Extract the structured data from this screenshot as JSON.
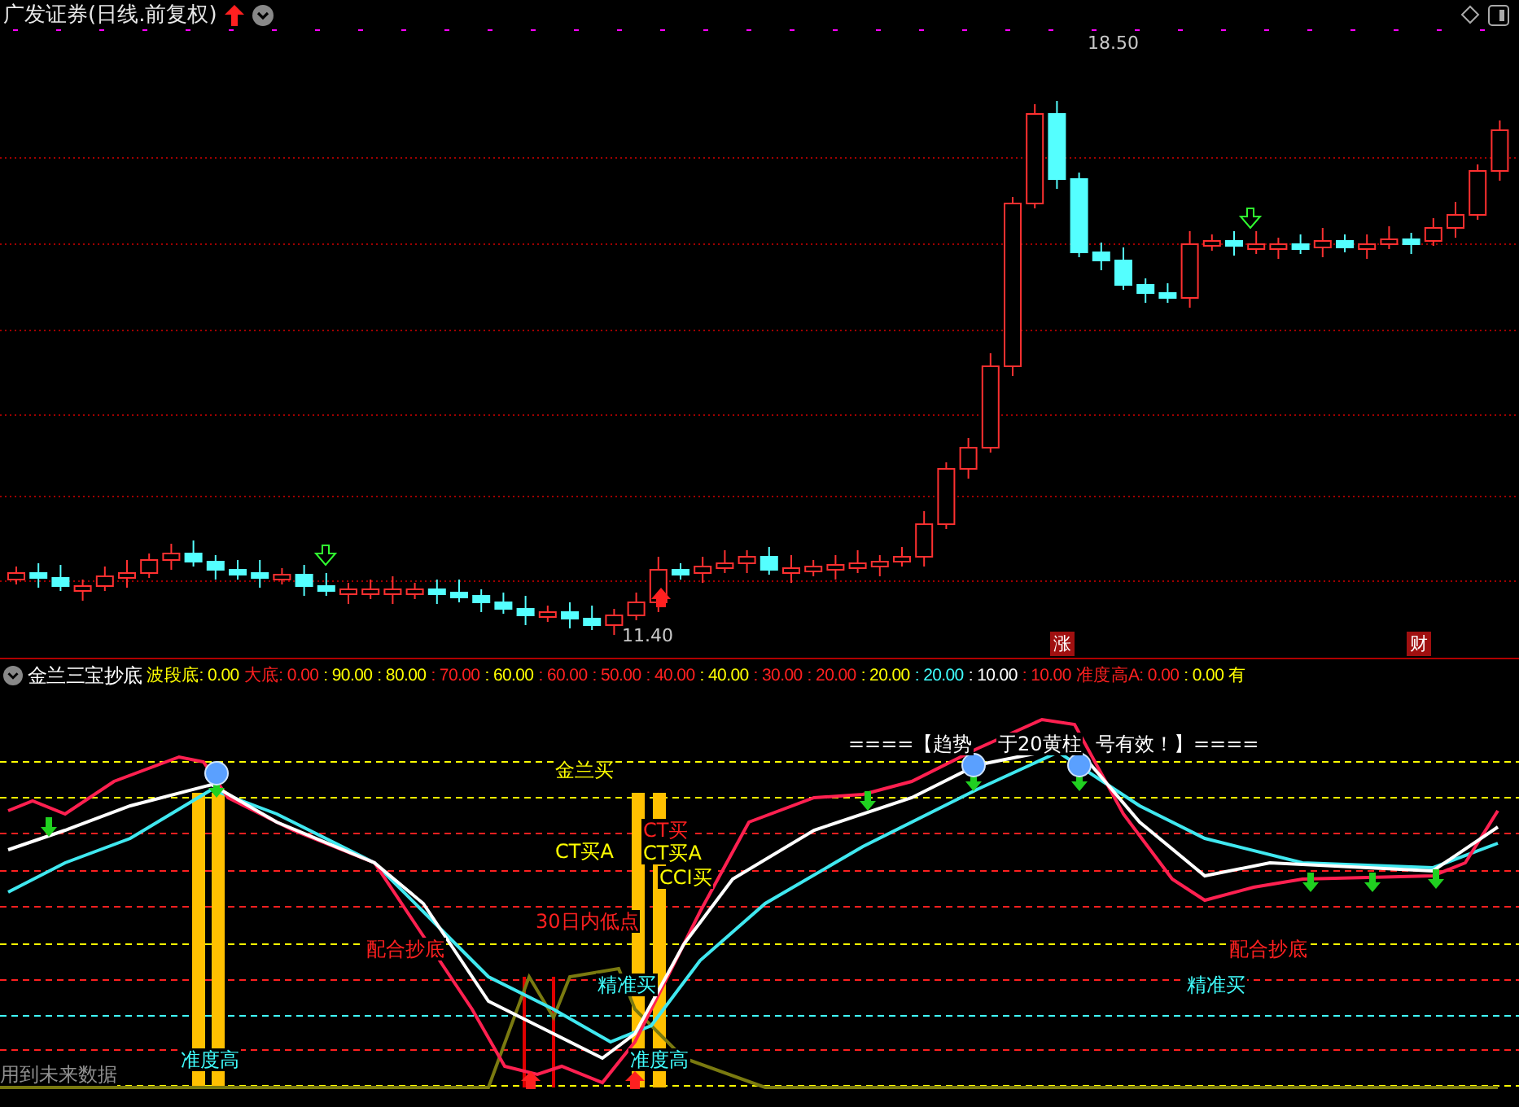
{
  "header": {
    "title": "广发证券(日线.前复权)"
  },
  "price_chart": {
    "high_label": "18.50",
    "low_label": "11.40",
    "badges": [
      "涨",
      "财"
    ]
  },
  "indicator": {
    "name": "金兰三宝抄底",
    "legend": [
      {
        "text": "波段底: 0.00",
        "color": "#ffff00"
      },
      {
        "text": "大底: 0.00",
        "color": "#ff2020"
      },
      {
        "text": ": 90.00",
        "color": "#ffff00"
      },
      {
        "text": ": 80.00",
        "color": "#ffff00"
      },
      {
        "text": ": 70.00",
        "color": "#ff2020"
      },
      {
        "text": ": 60.00",
        "color": "#ffff00"
      },
      {
        "text": ": 60.00",
        "color": "#ff2020"
      },
      {
        "text": ": 50.00",
        "color": "#ff2020"
      },
      {
        "text": ": 40.00",
        "color": "#ff2020"
      },
      {
        "text": ": 40.00",
        "color": "#ffff00"
      },
      {
        "text": ": 30.00",
        "color": "#ff2020"
      },
      {
        "text": ": 20.00",
        "color": "#ff2020"
      },
      {
        "text": ": 20.00",
        "color": "#ffff00"
      },
      {
        "text": ": 20.00",
        "color": "#40ffff"
      },
      {
        "text": ": 10.00",
        "color": "#ffffff"
      },
      {
        "text": ": 10.00",
        "color": "#ff2020"
      },
      {
        "text": "准度高A: 0.00",
        "color": "#ff2020"
      },
      {
        "text": ": 0.00",
        "color": "#ffff00"
      },
      {
        "text": "有",
        "color": "#ffff00"
      }
    ]
  },
  "annotations": [
    {
      "text": "====【趋势",
      "color": "#ffffff"
    },
    {
      "text": "于20黄柱",
      "color": "#ffffff"
    },
    {
      "text": "号有效！】====",
      "color": "#ffffff"
    },
    {
      "text": "金兰买",
      "color": "#ffff00"
    },
    {
      "text": "CT买A",
      "color": "#ffff00"
    },
    {
      "text": "CT买",
      "color": "#ff2020"
    },
    {
      "text": "CT买A",
      "color": "#ffff00"
    },
    {
      "text": "CCI买",
      "color": "#ffff00"
    },
    {
      "text": "30日内低点",
      "color": "#ff2020"
    },
    {
      "text": "配合抄底",
      "color": "#ff2020"
    },
    {
      "text": "精准买",
      "color": "#40ffff"
    },
    {
      "text": "准度高",
      "color": "#40ffff"
    },
    {
      "text": "准度高",
      "color": "#40ffff"
    },
    {
      "text": "配合抄底",
      "color": "#ff2020"
    },
    {
      "text": "精准买",
      "color": "#40ffff"
    }
  ],
  "footnote": "用到未来数据"
}
